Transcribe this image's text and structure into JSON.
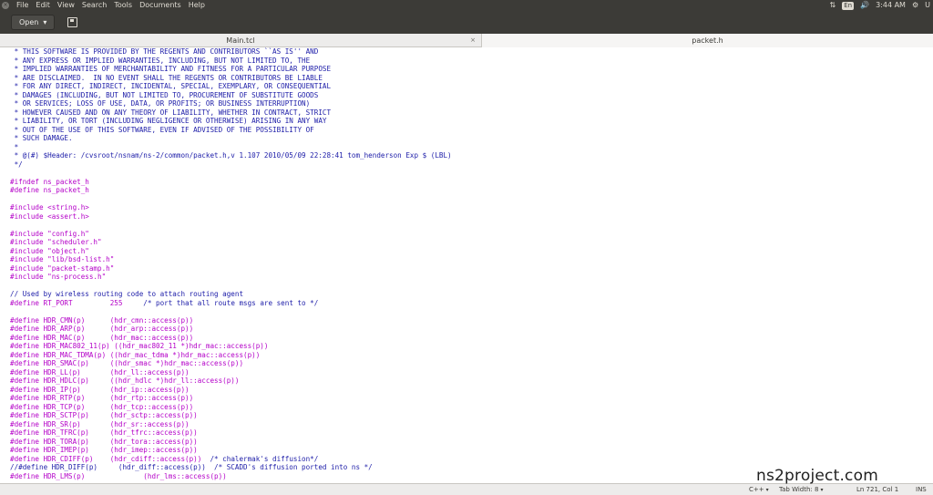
{
  "top_panel": {
    "menus": [
      "File",
      "Edit",
      "View",
      "Search",
      "Tools",
      "Documents",
      "Help"
    ],
    "keyboard_layout": "En",
    "time": "3:44 AM",
    "user_initial": "U"
  },
  "toolbar": {
    "open_label": "Open",
    "open_chevron": "▾"
  },
  "tabs": [
    {
      "label": "Main.tcl",
      "close": "×"
    },
    {
      "label": "packet.h"
    }
  ],
  "editor": {
    "lines": [
      {
        "kind": "cm",
        "text": " * THIS SOFTWARE IS PROVIDED BY THE REGENTS AND CONTRIBUTORS ``AS IS'' AND"
      },
      {
        "kind": "cm",
        "text": " * ANY EXPRESS OR IMPLIED WARRANTIES, INCLUDING, BUT NOT LIMITED TO, THE"
      },
      {
        "kind": "cm",
        "text": " * IMPLIED WARRANTIES OF MERCHANTABILITY AND FITNESS FOR A PARTICULAR PURPOSE"
      },
      {
        "kind": "cm",
        "text": " * ARE DISCLAIMED.  IN NO EVENT SHALL THE REGENTS OR CONTRIBUTORS BE LIABLE"
      },
      {
        "kind": "cm",
        "text": " * FOR ANY DIRECT, INDIRECT, INCIDENTAL, SPECIAL, EXEMPLARY, OR CONSEQUENTIAL"
      },
      {
        "kind": "cm",
        "text": " * DAMAGES (INCLUDING, BUT NOT LIMITED TO, PROCUREMENT OF SUBSTITUTE GOODS"
      },
      {
        "kind": "cm",
        "text": " * OR SERVICES; LOSS OF USE, DATA, OR PROFITS; OR BUSINESS INTERRUPTION)"
      },
      {
        "kind": "cm",
        "text": " * HOWEVER CAUSED AND ON ANY THEORY OF LIABILITY, WHETHER IN CONTRACT, STRICT"
      },
      {
        "kind": "cm",
        "text": " * LIABILITY, OR TORT (INCLUDING NEGLIGENCE OR OTHERWISE) ARISING IN ANY WAY"
      },
      {
        "kind": "cm",
        "text": " * OUT OF THE USE OF THIS SOFTWARE, EVEN IF ADVISED OF THE POSSIBILITY OF"
      },
      {
        "kind": "cm",
        "text": " * SUCH DAMAGE."
      },
      {
        "kind": "cm",
        "text": " *"
      },
      {
        "kind": "cm",
        "text": " * @(#) $Header: /cvsroot/nsnam/ns-2/common/packet.h,v 1.107 2010/05/09 22:28:41 tom_henderson Exp $ (LBL)"
      },
      {
        "kind": "cm",
        "text": " */"
      },
      {
        "kind": "cd",
        "text": ""
      },
      {
        "kind": "pp",
        "text": "#ifndef ns_packet_h"
      },
      {
        "kind": "pp",
        "text": "#define ns_packet_h"
      },
      {
        "kind": "cd",
        "text": ""
      },
      {
        "kind": "pp",
        "text": "#include <string.h>"
      },
      {
        "kind": "pp",
        "text": "#include <assert.h>"
      },
      {
        "kind": "cd",
        "text": ""
      },
      {
        "kind": "pp",
        "text": "#include \"config.h\""
      },
      {
        "kind": "pp",
        "text": "#include \"scheduler.h\""
      },
      {
        "kind": "pp",
        "text": "#include \"object.h\""
      },
      {
        "kind": "pp",
        "text": "#include \"lib/bsd-list.h\""
      },
      {
        "kind": "pp",
        "text": "#include \"packet-stamp.h\""
      },
      {
        "kind": "pp",
        "text": "#include \"ns-process.h\""
      },
      {
        "kind": "cd",
        "text": ""
      },
      {
        "kind": "cm",
        "text": "// Used by wireless routing code to attach routing agent"
      },
      {
        "kind": "mixed",
        "pp": "#define RT_PORT         255",
        "cm": "     /* port that all route msgs are sent to */"
      },
      {
        "kind": "cd",
        "text": ""
      },
      {
        "kind": "pp",
        "text": "#define HDR_CMN(p)      (hdr_cmn::access(p))"
      },
      {
        "kind": "pp",
        "text": "#define HDR_ARP(p)      (hdr_arp::access(p))"
      },
      {
        "kind": "pp",
        "text": "#define HDR_MAC(p)      (hdr_mac::access(p))"
      },
      {
        "kind": "pp",
        "text": "#define HDR_MAC802_11(p) ((hdr_mac802_11 *)hdr_mac::access(p))"
      },
      {
        "kind": "pp",
        "text": "#define HDR_MAC_TDMA(p) ((hdr_mac_tdma *)hdr_mac::access(p))"
      },
      {
        "kind": "pp",
        "text": "#define HDR_SMAC(p)     ((hdr_smac *)hdr_mac::access(p))"
      },
      {
        "kind": "pp",
        "text": "#define HDR_LL(p)       (hdr_ll::access(p))"
      },
      {
        "kind": "pp",
        "text": "#define HDR_HDLC(p)     ((hdr_hdlc *)hdr_ll::access(p))"
      },
      {
        "kind": "pp",
        "text": "#define HDR_IP(p)       (hdr_ip::access(p))"
      },
      {
        "kind": "pp",
        "text": "#define HDR_RTP(p)      (hdr_rtp::access(p))"
      },
      {
        "kind": "pp",
        "text": "#define HDR_TCP(p)      (hdr_tcp::access(p))"
      },
      {
        "kind": "pp",
        "text": "#define HDR_SCTP(p)     (hdr_sctp::access(p))"
      },
      {
        "kind": "pp",
        "text": "#define HDR_SR(p)       (hdr_sr::access(p))"
      },
      {
        "kind": "pp",
        "text": "#define HDR_TFRC(p)     (hdr_tfrc::access(p))"
      },
      {
        "kind": "pp",
        "text": "#define HDR_TORA(p)     (hdr_tora::access(p))"
      },
      {
        "kind": "pp",
        "text": "#define HDR_IMEP(p)     (hdr_imep::access(p))"
      },
      {
        "kind": "mixed",
        "pp": "#define HDR_CDIFF(p)    (hdr_cdiff::access(p))",
        "cm": "  /* chalermak's diffusion*/"
      },
      {
        "kind": "mixed2",
        "cm": "//#define HDR_DIFF(p)     (hdr_diff::access(p))  /* SCADD's diffusion ported into ns */"
      },
      {
        "kind": "pp",
        "text": "#define HDR_LMS(p)              (hdr_lms::access(p))"
      }
    ]
  },
  "statusbar": {
    "language": "C++",
    "tab_width": "Tab Width: 8",
    "position": "Ln 721, Col 1",
    "overwrite": "INS"
  },
  "watermark": "ns2project.com"
}
